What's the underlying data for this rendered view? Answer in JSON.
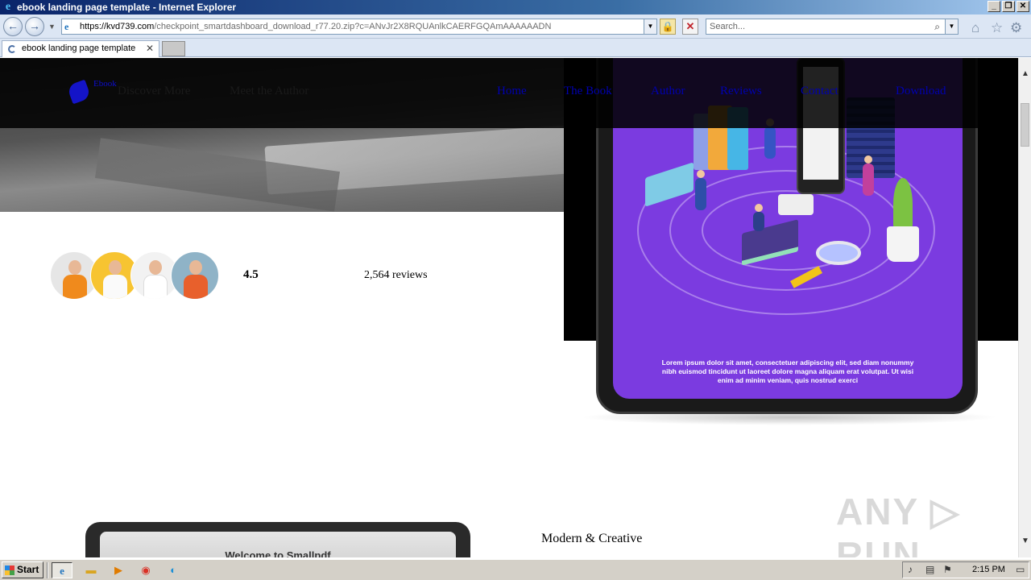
{
  "window": {
    "title": "ebook landing page template - Internet Explorer",
    "logo_glyph": "e",
    "controls": {
      "minimize": "_",
      "restore": "❐",
      "close": "✕"
    }
  },
  "addressbar": {
    "url_domain": "https://kvd739.com",
    "url_path": "/checkpoint_smartdashboard_download_r77.20.zip?c=ANvJr2X8RQUAnlkCAERFGQAmAAAAAADN",
    "search_placeholder": "Search...",
    "back_glyph": "←",
    "forward_glyph": "→"
  },
  "tabs": [
    {
      "label": "ebook landing page template",
      "close": "✕"
    }
  ],
  "site": {
    "brand_text": "Ebook",
    "nav_left": [
      "Discover More",
      "Meet the Author"
    ],
    "nav_right": [
      "Home",
      "The Book",
      "Author",
      "Reviews",
      "Contact",
      "Download"
    ],
    "phone_caption": "Lorem ipsum dolor sit amet, consectetuer adipiscing elit, sed diam nonummy nibh euismod tincidunt ut laoreet dolore magna aliquam erat volutpat. Ut wisi enim ad minim veniam, quis nostrud exerci",
    "rating": "4.5",
    "reviews": "2,564 reviews",
    "tablet_welcome": "Welcome to Smallpdf",
    "section_title": "Modern & Creative",
    "watermark": "ANY.RUN"
  },
  "taskbar": {
    "start_label": "Start",
    "clock": "2:15 PM"
  },
  "icons": {
    "window": "ie-logo-icon",
    "address": [
      "page-icon",
      "lock-icon",
      "stop-icon",
      "search-icon"
    ],
    "toolbar": [
      "home-icon",
      "favorites-icon",
      "settings-icon"
    ],
    "taskbar": [
      "ie-icon",
      "folder-icon",
      "media-player-icon",
      "chrome-icon",
      "edge-icon"
    ],
    "tray": [
      "volume-icon",
      "network-icon",
      "flag-icon",
      "display-icon"
    ]
  },
  "colors": {
    "titlebar_start": "#0a246a",
    "titlebar_end": "#a6caf0",
    "nav_link_blue": "#0000b0",
    "phone_screen": "#7b3be0"
  }
}
